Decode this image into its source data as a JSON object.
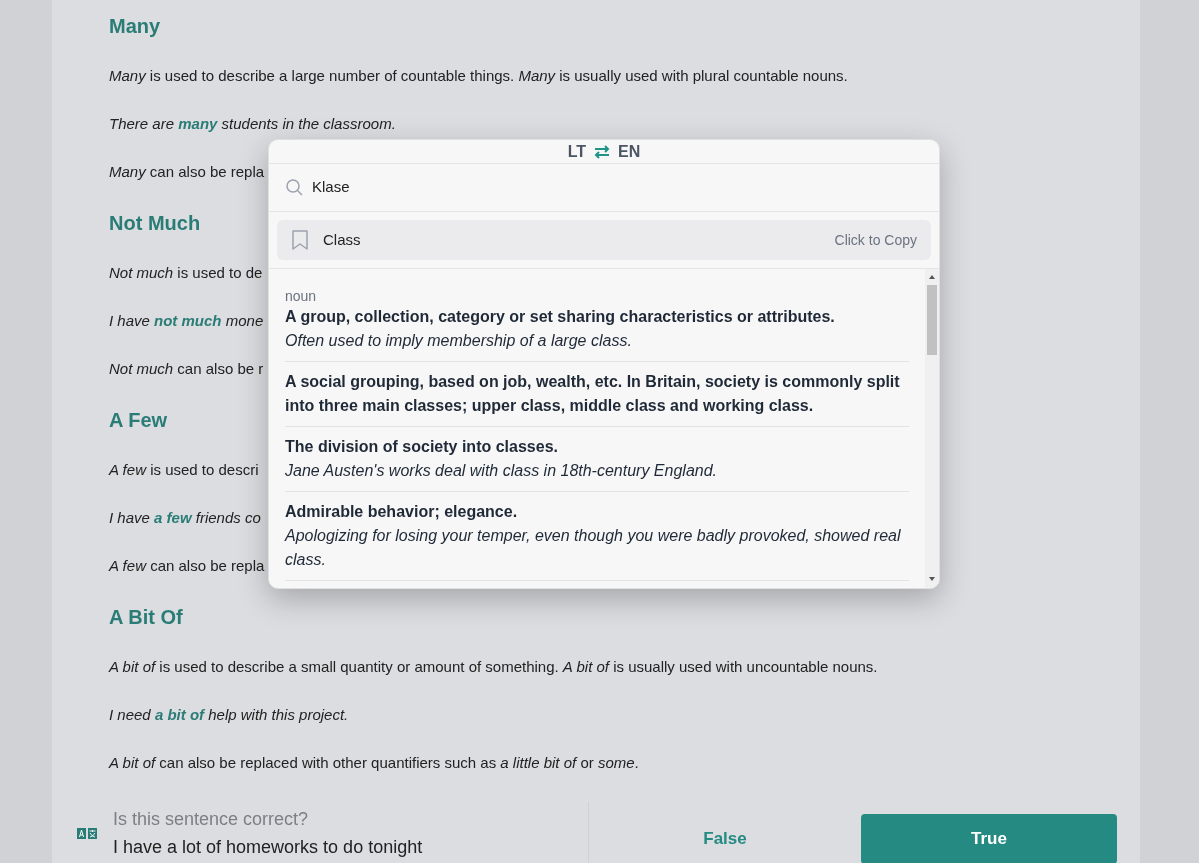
{
  "sections": [
    {
      "heading": "Many",
      "paragraphs": [
        {
          "kind": "rule",
          "text": "*Many* is used to describe a large number of countable things. *Many* is usually used with plural countable nouns."
        },
        {
          "kind": "example",
          "text": "There are **many** students in the classroom."
        },
        {
          "kind": "rule",
          "text": "*Many* can also be repla"
        }
      ]
    },
    {
      "heading": "Not Much",
      "paragraphs": [
        {
          "kind": "rule",
          "text": "*Not much* is used to de"
        },
        {
          "kind": "example",
          "text": "I have **not much** mone"
        },
        {
          "kind": "rule",
          "text": "*Not much* can also be r"
        }
      ]
    },
    {
      "heading": "A Few",
      "paragraphs": [
        {
          "kind": "rule",
          "text": "*A few* is used to descri"
        },
        {
          "kind": "example",
          "text": "I have **a few** friends co"
        },
        {
          "kind": "rule",
          "text": "*A few* can also be repla"
        }
      ]
    },
    {
      "heading": "A Bit Of",
      "paragraphs": [
        {
          "kind": "rule",
          "text": "*A bit of* is used to describe a small quantity or amount of something. *A bit of* is usually used with uncountable nouns."
        },
        {
          "kind": "example",
          "text": "I need **a bit of** help with this project."
        },
        {
          "kind": "rule",
          "text": "*A bit of* can also be replaced with other quantifiers such as *a little bit of* or *some*."
        }
      ]
    }
  ],
  "translator": {
    "source_lang": "LT",
    "target_lang": "EN",
    "search": {
      "value": "Klase"
    },
    "result": {
      "word": "Class",
      "action": "Click to Copy"
    },
    "definitions": [
      {
        "part_of_speech": "noun",
        "definition": "A group, collection, category or set sharing characteristics or attributes.",
        "example": "Often used to imply membership of a large class."
      },
      {
        "definition": "A social grouping, based on job, wealth, etc. In Britain, society is commonly split into three main classes; upper class, middle class and working class."
      },
      {
        "definition": "The division of society into classes.",
        "example": "Jane Austen's works deal with class in 18th-century England."
      },
      {
        "definition": "Admirable behavior; elegance.",
        "example": "Apologizing for losing your temper, even though you were badly provoked, showed real class."
      }
    ]
  },
  "quiz": {
    "question": "Is this sentence correct?",
    "sentence": "I have a lot of homeworks to do tonight",
    "answers": [
      {
        "label": "False",
        "selected": false
      },
      {
        "label": "True",
        "selected": true
      }
    ]
  }
}
